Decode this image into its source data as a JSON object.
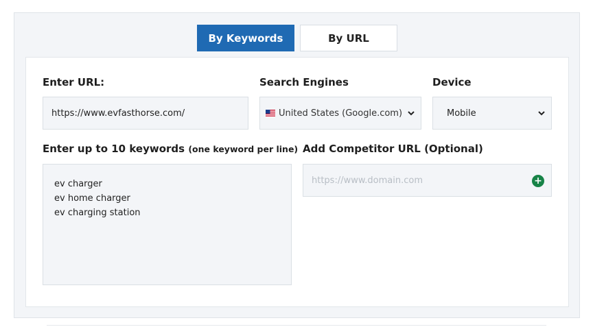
{
  "tabs": {
    "keywords": "By Keywords",
    "url": "By URL"
  },
  "url_field": {
    "label": "Enter URL:",
    "value": "https://www.evfasthorse.com/"
  },
  "search_engines": {
    "label": "Search Engines",
    "selected": "United States (Google.com)",
    "flag_icon": "us-flag-icon"
  },
  "device": {
    "label": "Device",
    "selected": "Mobile"
  },
  "keywords": {
    "label": "Enter up to 10 keywords",
    "hint": "(one keyword per line)",
    "lines": [
      "ev charger",
      "ev home charger",
      "ev charging station"
    ]
  },
  "competitor": {
    "label": "Add Competitor URL (Optional)",
    "placeholder": "https://www.domain.com",
    "add_icon": "plus-circle-icon"
  },
  "colors": {
    "accent": "#1f6ab3",
    "add_button": "#178347"
  }
}
